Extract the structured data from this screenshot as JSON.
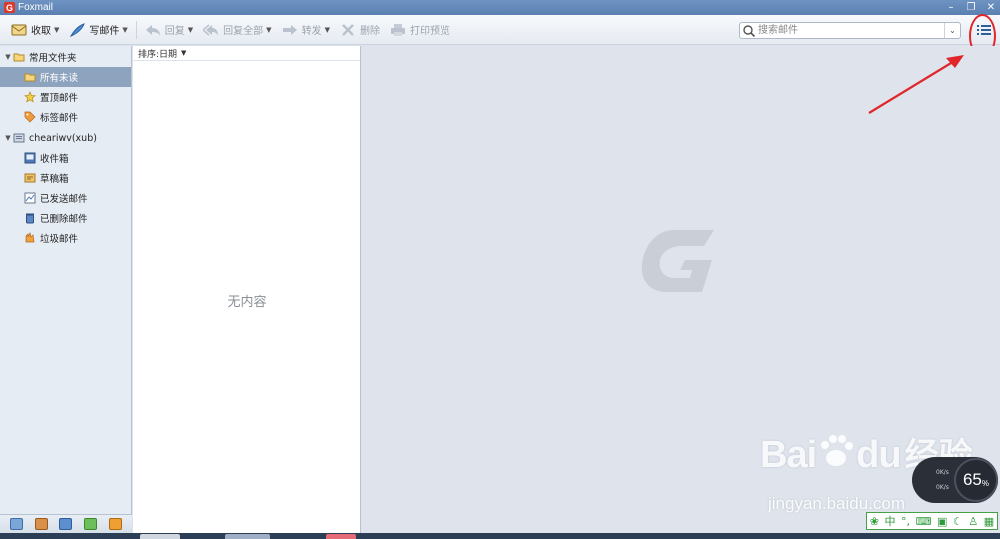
{
  "window": {
    "title": "Foxmail",
    "logo_letter": "G"
  },
  "toolbar": {
    "receive_label": "收取",
    "compose_label": "写邮件",
    "reply_label": "回复",
    "reply_all_label": "回复全部",
    "forward_label": "转发",
    "delete_label": "删除",
    "print_preview_label": "打印预览"
  },
  "search": {
    "placeholder": "搜索邮件"
  },
  "sidebar": {
    "groups": [
      {
        "label": "常用文件夹",
        "items": [
          {
            "label": "所有未读"
          },
          {
            "label": "置顶邮件"
          },
          {
            "label": "标签邮件"
          }
        ]
      },
      {
        "label": "cheariwv(xub)",
        "items": [
          {
            "label": "收件箱"
          },
          {
            "label": "草稿箱"
          },
          {
            "label": "已发送邮件"
          },
          {
            "label": "已删除邮件"
          },
          {
            "label": "垃圾邮件"
          }
        ]
      }
    ]
  },
  "message_list": {
    "sort_label": "排序:日期",
    "empty_text": "无内容"
  },
  "overlay": {
    "baidu_brand": "Bai",
    "baidu_brand_tail": "du",
    "baidu_cn": "经验",
    "baidu_url": "jingyan.baidu.com",
    "speed_up": "0K/s",
    "speed_down": "0K/s",
    "speed_percent": "65",
    "speed_percent_unit": "%",
    "ime_mode": "中"
  },
  "colors": {
    "annotation": "#e0262a",
    "selected_row": "#8ea3bd",
    "titlebar": "#5a80b3"
  }
}
